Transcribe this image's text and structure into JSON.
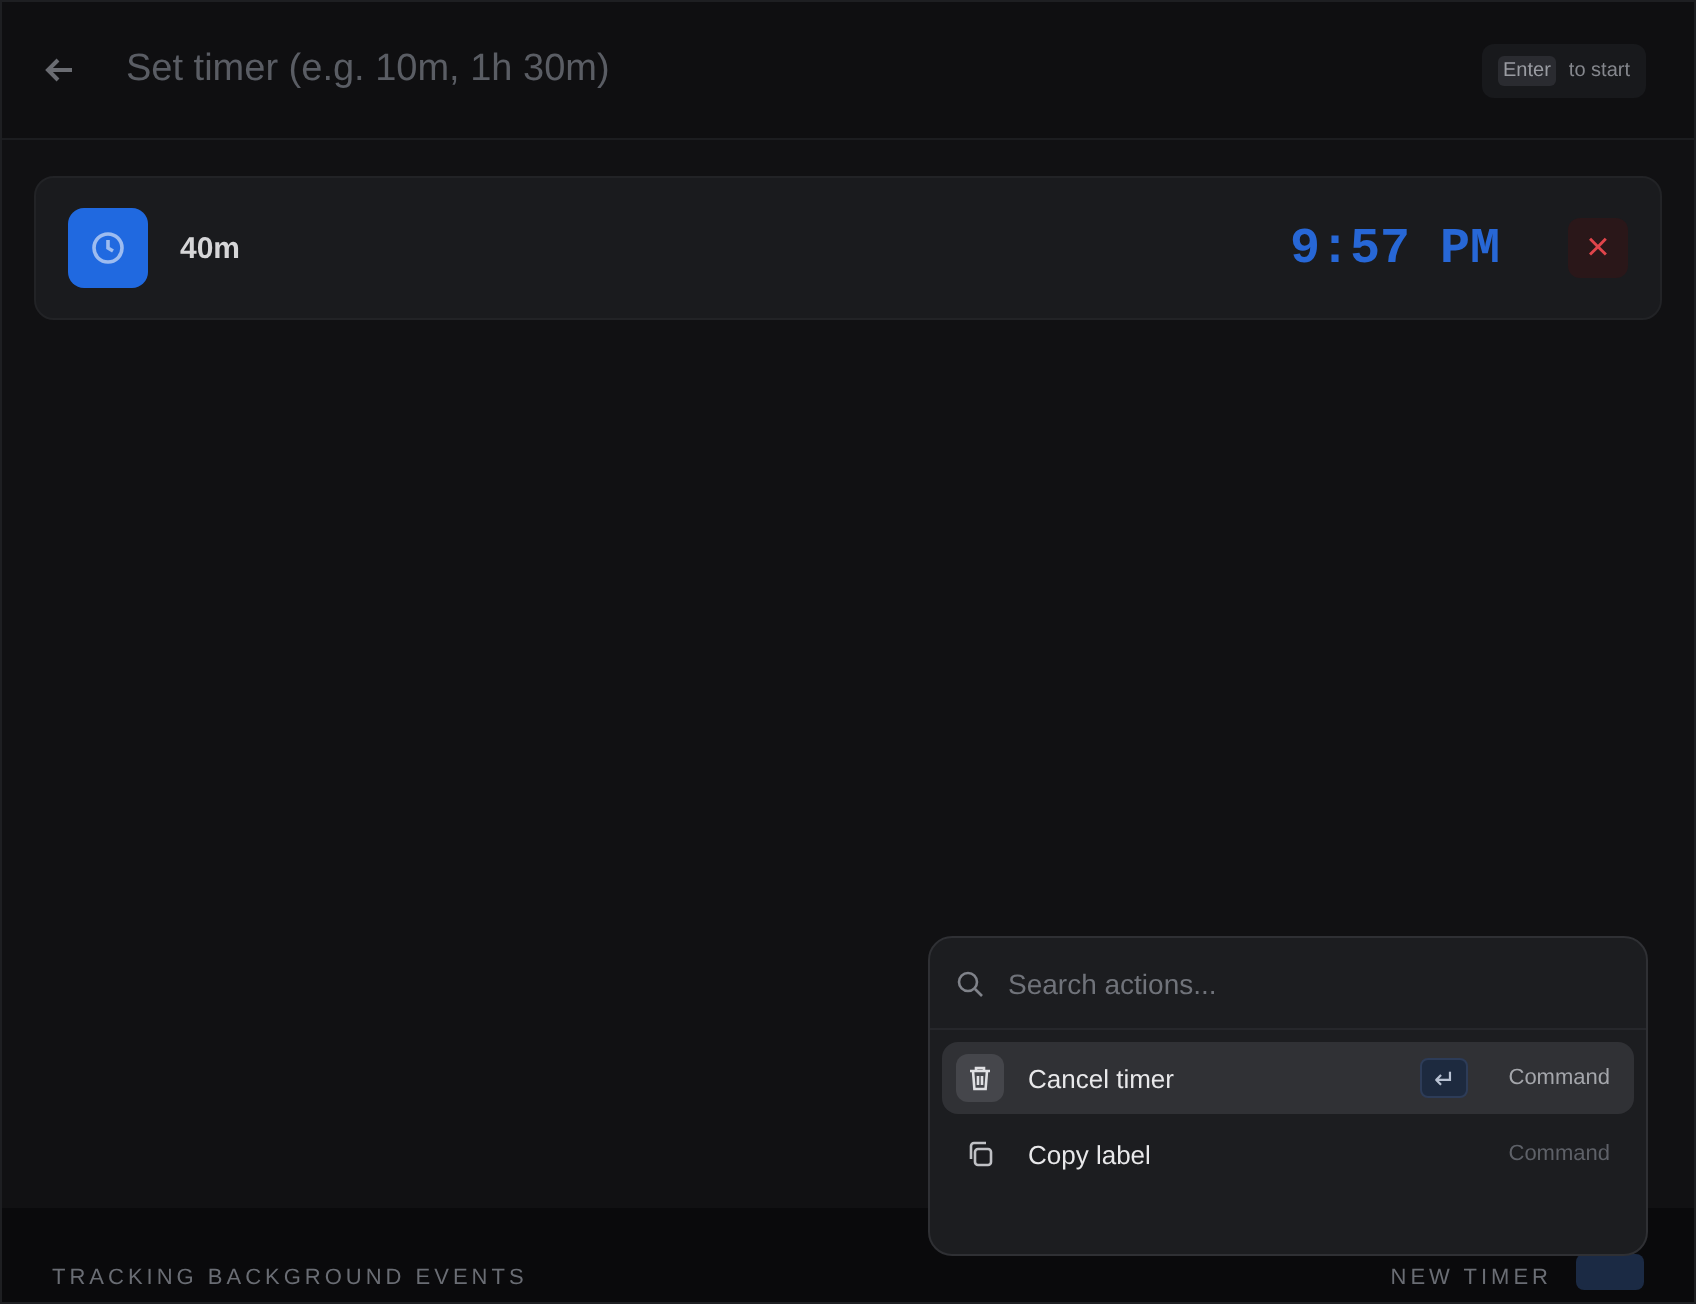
{
  "header": {
    "placeholder": "Set timer (e.g. 10m, 1h 30m)",
    "hint_key": "Enter",
    "hint_text": "to start"
  },
  "timers": [
    {
      "label": "40m",
      "end_time": "9:57 PM",
      "cancel": "×"
    }
  ],
  "footer": {
    "status": "TRACKING BACKGROUND EVENTS",
    "action": "NEW TIMER"
  },
  "action_menu": {
    "search_placeholder": "Search actions...",
    "items": [
      {
        "kind": "trash",
        "label": "Cancel timer",
        "key": "↵",
        "shortcut": "Command",
        "selected": true
      },
      {
        "kind": "copy",
        "label": "Copy label",
        "shortcut": "Command",
        "selected": false
      }
    ]
  }
}
